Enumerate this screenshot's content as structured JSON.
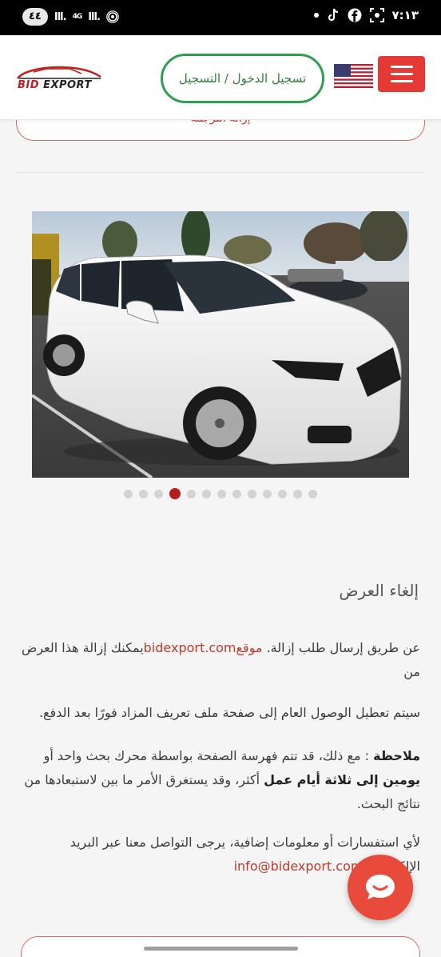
{
  "status_bar": {
    "badge": "٤٤",
    "network": "4G",
    "time": "٧:١٣"
  },
  "header": {
    "logo": "BID EXPORT",
    "login_label": "تسجيل الدخول / التسجيل",
    "flag": "us-flag-icon",
    "menu_icon": "hamburger-menu-icon"
  },
  "top_button": {
    "label": "إزالة الترجمة"
  },
  "carousel": {
    "total": 13,
    "active_index": 3
  },
  "content": {
    "title": "إلغاء العرض",
    "p1_a": "يمكنك إزالة هذا العرض من",
    "p1_link": "bidexport.com",
    "p1_b": "موقع",
    "p1_c": "عن طريق إرسال طلب إزالة.",
    "p2": "سيتم تعطيل الوصول العام إلى صفحة ملف تعريف المزاد فورًا بعد الدفع.",
    "p3_a": "ملاحظة",
    "p3_b": ": مع ذلك، قد تتم فهرسة الصفحة بواسطة محرك بحث واحد أو",
    "p3_c": "أكثر، وقد يستغرق الأمر ما بين",
    "p3_d": "يومين إلى ثلاثة أيام عمل",
    "p3_e": "لاستبعادها من نتائج البحث.",
    "p4_a": "لأي استفسارات أو معلومات إضافية، يرجى التواصل معنا عبر البريد الإلكتروني",
    "p4_link": "info@bidexport.com"
  },
  "colors": {
    "accent_red": "#e53935",
    "login_green": "#2e9e4f",
    "link_red": "#c0392b",
    "active_dot": "#b71c1c"
  },
  "icons": [
    "chat-icon",
    "tiktok-icon",
    "facebook-icon"
  ]
}
